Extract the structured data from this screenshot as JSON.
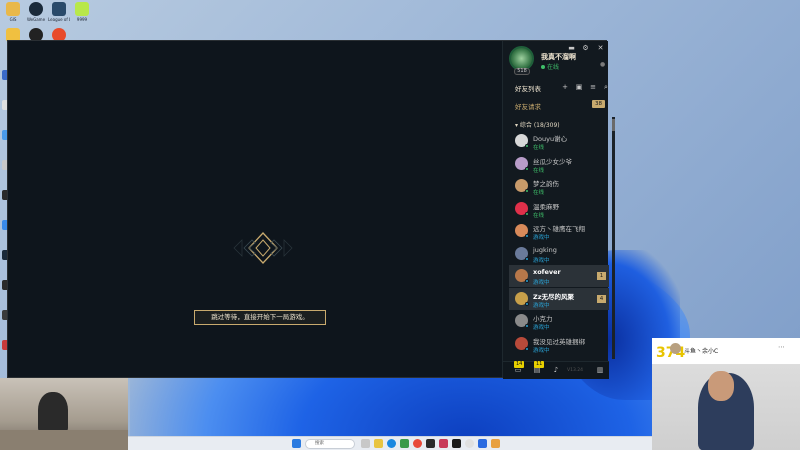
{
  "desktop": {
    "icons": [
      {
        "label": "GIS",
        "color": "#e8b84a"
      },
      {
        "label": "WeGame",
        "color": "#1a2a3a"
      },
      {
        "label": "League of Legends",
        "color": "#2a4a6a"
      },
      {
        "label": "9999",
        "color": "#b8e84a"
      }
    ]
  },
  "client": {
    "skip_button": "跳过等待，直接开始下一局游戏。",
    "profile": {
      "name": "我真不溜啊",
      "status": "在线",
      "level": "518"
    },
    "friend_list_title": "好友列表",
    "friend_requests_label": "好友请求",
    "friend_requests_count": "38",
    "group_label": "综合 (18/309)",
    "friends": [
      {
        "name": "Douyu谢心",
        "status": "在线",
        "state": "online",
        "avatar": "#d8d8d8"
      },
      {
        "name": "丝瓜少女少爷",
        "status": "在线",
        "state": "online",
        "avatar": "#b89cc8"
      },
      {
        "name": "梦之韵伤",
        "status": "在线",
        "state": "online",
        "avatar": "#c89a6a"
      },
      {
        "name": "温柔麻野",
        "status": "在线",
        "state": "online",
        "avatar": "#e0304a"
      },
      {
        "name": "远方丶雄鹰在飞翔",
        "status": "游戏中",
        "state": "ingame",
        "avatar": "#d88a5a"
      },
      {
        "name": "jugking",
        "status": "游戏中",
        "state": "ingame",
        "avatar": "#6a7a9a"
      },
      {
        "name": "xofever",
        "status": "游戏中",
        "state": "ingame",
        "avatar": "#b8784a",
        "highlight": true,
        "count": "1"
      },
      {
        "name": "Zz无尽的风聚",
        "status": "游戏中",
        "state": "ingame",
        "avatar": "#c8a04a",
        "highlight": true,
        "count": "4"
      },
      {
        "name": "小克力",
        "status": "游戏中",
        "state": "ingame",
        "avatar": "#8a8a8a"
      },
      {
        "name": "我没见过英雄捆绑",
        "status": "游戏中",
        "state": "ingame",
        "avatar": "#b84a3a"
      }
    ],
    "bottom_bar": {
      "chat_badge": "14",
      "messages_badge": "11",
      "version": "V13.24"
    }
  },
  "stream": {
    "viewer_number": "374",
    "streamer_name": "斗鱼丶余小C"
  },
  "taskbar": {
    "search_placeholder": "搜索"
  }
}
